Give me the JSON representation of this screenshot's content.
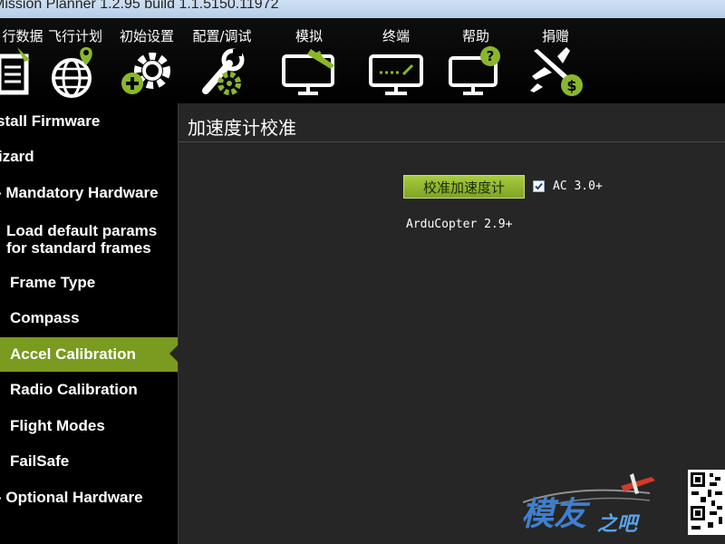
{
  "window": {
    "title": "Mission Planner 1.2.95 build 1.1.5150.11972"
  },
  "menu": [
    {
      "label": "行数据",
      "icon": "flight-data-icon"
    },
    {
      "label": "飞行计划",
      "icon": "globe-icon"
    },
    {
      "label": "初始设置",
      "icon": "gear-add-icon"
    },
    {
      "label": "配置/调试",
      "icon": "wrench-gear-icon"
    },
    {
      "label": "模拟",
      "icon": "monitor-plane-icon"
    },
    {
      "label": "终端",
      "icon": "terminal-monitor-icon"
    },
    {
      "label": "帮助",
      "icon": "help-monitor-icon"
    },
    {
      "label": "捐赠",
      "icon": "plane-dollar-icon"
    }
  ],
  "sidebar": {
    "items": [
      {
        "label": "stall Firmware"
      },
      {
        "label": "izard"
      },
      {
        "label": "- Mandatory Hardware"
      },
      {
        "label": "Load default params for standard frames"
      },
      {
        "label": "Frame Type"
      },
      {
        "label": "Compass"
      },
      {
        "label": "Accel Calibration",
        "active": true
      },
      {
        "label": "Radio Calibration"
      },
      {
        "label": "Flight Modes"
      },
      {
        "label": "FailSafe"
      },
      {
        "label": "- Optional Hardware"
      }
    ]
  },
  "panel": {
    "title": "加速度计校准",
    "calibrate_button": "校准加速度计",
    "ac30_checkbox_label": "AC 3.0+",
    "ac30_checked": true,
    "version_text": "ArduCopter 2.9+"
  },
  "watermark": {
    "text_main": "模友",
    "text_sub": "之吧"
  },
  "colors": {
    "accent": "#7a9a20",
    "icon_white": "#ffffff",
    "icon_green": "#8ab72a"
  }
}
